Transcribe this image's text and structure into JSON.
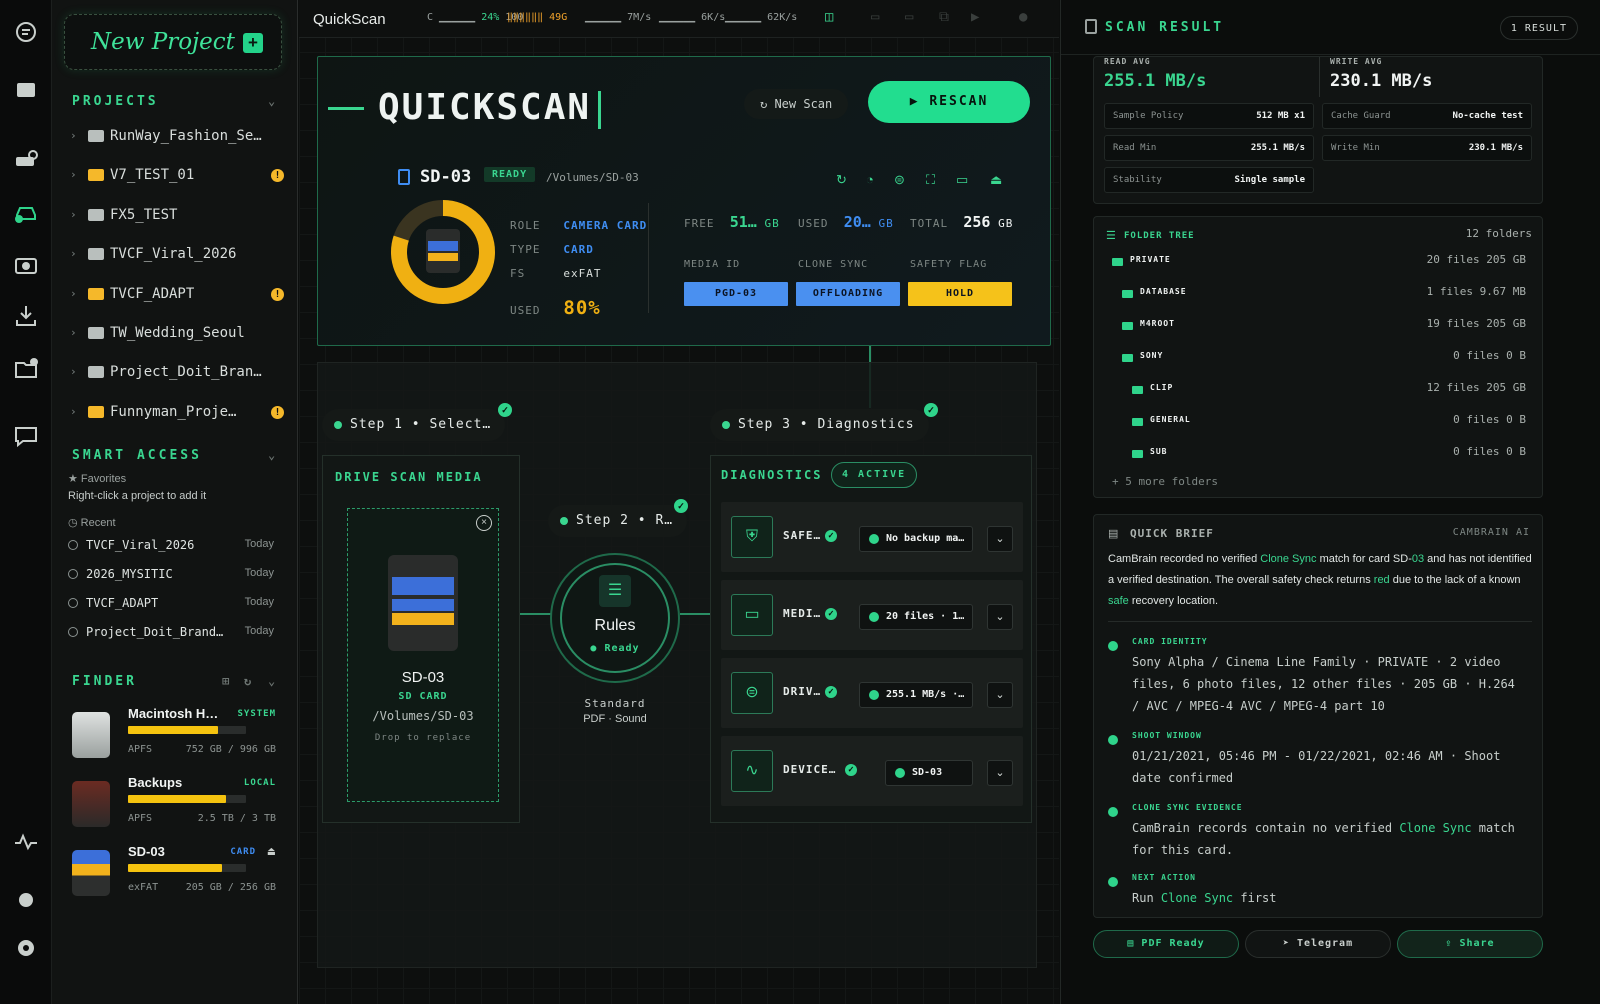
{
  "sidebar": {
    "new_project": "New Project",
    "projects_title": "PROJECTS",
    "projects": [
      {
        "name": "RunWay_Fashion_Se…",
        "warn": false,
        "yellow": false
      },
      {
        "name": "V7_TEST_01",
        "warn": true,
        "yellow": true
      },
      {
        "name": "FX5_TEST",
        "warn": false,
        "yellow": false
      },
      {
        "name": "TVCF_Viral_2026",
        "warn": false,
        "yellow": false
      },
      {
        "name": "TVCF_ADAPT",
        "warn": true,
        "yellow": true
      },
      {
        "name": "TW_Wedding_Seoul",
        "warn": false,
        "yellow": false
      },
      {
        "name": "Project_Doit_Bran…",
        "warn": false,
        "yellow": false
      },
      {
        "name": "Funnyman_Proje…",
        "warn": true,
        "yellow": true
      }
    ],
    "smart_access": "SMART ACCESS",
    "favorites": "Favorites",
    "favorites_hint": "Right-click a project to add it",
    "recent_title": "Recent",
    "recent": [
      {
        "name": "TVCF_Viral_2026",
        "date": "Today"
      },
      {
        "name": "2026_MYSITIC",
        "date": "Today"
      },
      {
        "name": "TVCF_ADAPT",
        "date": "Today"
      },
      {
        "name": "Project_Doit_Brand…",
        "date": "Today"
      }
    ],
    "finder_title": "FINDER",
    "drives": [
      {
        "name": "Macintosh H…",
        "tag": "SYSTEM",
        "fs": "APFS",
        "cap": "752 GB / 996 GB",
        "used": 0.76
      },
      {
        "name": "Backups",
        "tag": "LOCAL",
        "fs": "APFS",
        "cap": "2.5 TB / 3 TB",
        "used": 0.83
      },
      {
        "name": "SD-03",
        "tag": "CARD",
        "fs": "exFAT",
        "cap": "205 GB / 256 GB",
        "used": 0.8
      }
    ]
  },
  "topbar": {
    "title": "QuickScan",
    "cpu": "24%",
    "cpu_max": "100",
    "mem": "49G",
    "io1": "7M/s",
    "io2": "6K/s",
    "io3": "62K/s"
  },
  "hero": {
    "title": "QUICKSCAN",
    "new_scan": "New Scan",
    "rescan": "RESCAN",
    "device": "SD-03",
    "status": "READY",
    "path": "/Volumes/SD-03",
    "role_k": "ROLE",
    "role_v": "CAMERA CARD",
    "type_k": "TYPE",
    "type_v": "CARD",
    "fs_k": "FS",
    "fs_v": "exFAT",
    "used_k": "USED",
    "used_v": "80%",
    "used_frac": 0.8,
    "free_k": "FREE",
    "free_v": "51…",
    "free_u": "GB",
    "usedb_k": "USED",
    "usedb_v": "20…",
    "usedb_u": "GB",
    "total_k": "TOTAL",
    "total_v": "256",
    "total_u": "GB",
    "media_id_k": "MEDIA ID",
    "media_id_v": "PGD-03",
    "clone_k": "CLONE SYNC",
    "clone_v": "OFFLOADING",
    "flag_k": "SAFETY FLAG",
    "flag_v": "HOLD"
  },
  "flow": {
    "step1": "Step 1 • Select…",
    "step2": "Step 2 • R…",
    "step3": "Step 3 • Diagnostics",
    "media_title": "DRIVE SCAN MEDIA",
    "media_name": "SD-03",
    "media_type": "SD CARD",
    "media_path": "/Volumes/SD-03",
    "media_hint": "Drop to replace",
    "rules": "Rules",
    "rules_status": "Ready",
    "rules_sub1": "Standard",
    "rules_sub2": "PDF · Sound",
    "diag_title": "DIAGNOSTICS",
    "diag_active": "4 ACTIVE",
    "diag_rows": [
      {
        "name": "SAFE…",
        "status": "No backup ma…"
      },
      {
        "name": "MEDI…",
        "status": "20 files · 1…"
      },
      {
        "name": "DRIV…",
        "status": "255.1 MB/s ·…"
      },
      {
        "name": "DEVICE…",
        "status": "SD-03"
      }
    ]
  },
  "right": {
    "title": "SCAN RESULT",
    "count": "1 RESULT",
    "read_avg_k": "READ AVG",
    "read_avg_v": "255.1 MB/s",
    "write_avg_k": "WRITE AVG",
    "write_avg_v": "230.1 MB/s",
    "kv": [
      {
        "k": "Sample Policy",
        "v": "512 MB x1"
      },
      {
        "k": "Cache Guard",
        "v": "No-cache test"
      },
      {
        "k": "Read Min",
        "v": "255.1 MB/s"
      },
      {
        "k": "Write Min",
        "v": "230.1 MB/s"
      },
      {
        "k": "Stability",
        "v": "Single sample"
      }
    ],
    "tree_title": "FOLDER TREE",
    "tree_count": "12 folders",
    "tree": [
      {
        "n": "PRIVATE",
        "c": "20 files 205 GB",
        "d": 0
      },
      {
        "n": "DATABASE",
        "c": "1 files 9.67 MB",
        "d": 1
      },
      {
        "n": "M4ROOT",
        "c": "19 files 205 GB",
        "d": 1
      },
      {
        "n": "SONY",
        "c": "0 files 0 B",
        "d": 1
      },
      {
        "n": "CLIP",
        "c": "12 files 205 GB",
        "d": 2
      },
      {
        "n": "GENERAL",
        "c": "0 files 0 B",
        "d": 2
      },
      {
        "n": "SUB",
        "c": "0 files 0 B",
        "d": 2
      }
    ],
    "tree_more": "+ 5 more folders",
    "brief_title": "QUICK BRIEF",
    "brief_src": "CAMBRAIN AI",
    "brief_1": "CamBrain recorded no verified ",
    "brief_2": "Clone Sync",
    "brief_3": " match for card SD-",
    "brief_4": "03",
    "brief_5": " and has not identified a verified destination. The overall safety check returns ",
    "brief_6": "red",
    "brief_7": " due to the lack of a known ",
    "brief_8": "safe",
    "brief_9": " recovery location.",
    "s1_title": "CARD IDENTITY",
    "s1_text": "Sony Alpha / Cinema Line Family · PRIVATE · 2 video files, 6 photo files, 12 other files · 205 GB · H.264 / AVC / MPEG-4 AVC / MPEG-4 part 10",
    "s2_title": "SHOOT WINDOW",
    "s2_text": "01/21/2021, 05:46 PM - 01/22/2021, 02:46 AM · Shoot date confirmed",
    "s3_title": "CLONE SYNC EVIDENCE",
    "s3_a": "CamBrain records contain no verified ",
    "s3_b": "Clone Sync",
    "s3_c": " match for this card.",
    "s4_title": "NEXT ACTION",
    "s4_a": "Run ",
    "s4_b": "Clone Sync",
    "s4_c": " first",
    "btn_pdf": "PDF Ready",
    "btn_tg": "Telegram",
    "btn_share": "Share"
  }
}
